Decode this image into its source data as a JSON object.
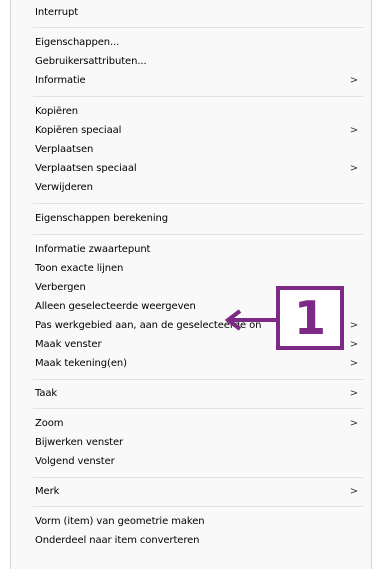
{
  "menu": {
    "items": [
      {
        "label": "Interrupt",
        "submenu": false
      },
      {
        "label": "Eigenschappen...",
        "submenu": false
      },
      {
        "label": "Gebruikersattributen...",
        "submenu": false
      },
      {
        "label": "Informatie",
        "submenu": true
      },
      {
        "label": "Kopiëren",
        "submenu": false
      },
      {
        "label": "Kopiëren speciaal",
        "submenu": true
      },
      {
        "label": "Verplaatsen",
        "submenu": false
      },
      {
        "label": "Verplaatsen speciaal",
        "submenu": true
      },
      {
        "label": "Verwijderen",
        "submenu": false
      },
      {
        "label": "Eigenschappen berekening",
        "submenu": false
      },
      {
        "label": "Informatie zwaartepunt",
        "submenu": false
      },
      {
        "label": "Toon exacte lijnen",
        "submenu": false
      },
      {
        "label": "Verbergen",
        "submenu": false
      },
      {
        "label": "Alleen geselecteerde weergeven",
        "submenu": false
      },
      {
        "label": "Pas werkgebied aan, aan de geselecteerde on",
        "submenu": true
      },
      {
        "label": "Maak venster",
        "submenu": true
      },
      {
        "label": "Maak tekening(en)",
        "submenu": true
      },
      {
        "label": "Taak",
        "submenu": true
      },
      {
        "label": "Zoom",
        "submenu": true
      },
      {
        "label": "Bijwerken venster",
        "submenu": false
      },
      {
        "label": "Volgend venster",
        "submenu": false
      },
      {
        "label": "Merk",
        "submenu": true
      },
      {
        "label": "Vorm (item) van geometrie maken",
        "submenu": false
      },
      {
        "label": "Onderdeel naar item converteren",
        "submenu": false
      }
    ],
    "submenu_arrow": ">"
  },
  "callout": {
    "number": "1",
    "color": "#7d2a86"
  },
  "icons": {
    "callout_arrow": "arrow-left-icon",
    "submenu_arrow": "chevron-right-icon"
  }
}
